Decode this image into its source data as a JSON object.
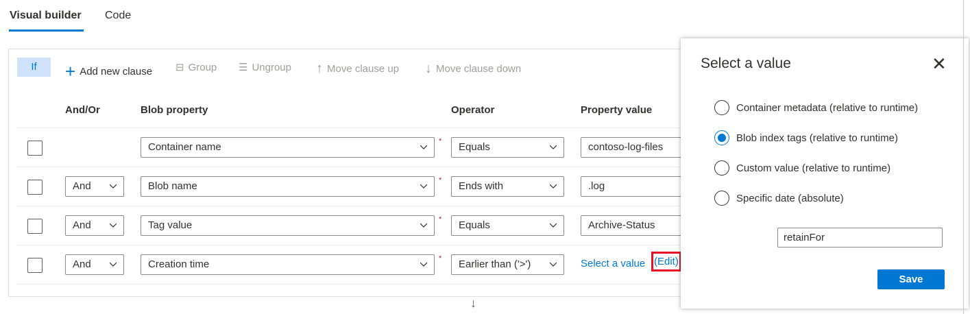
{
  "tabs": [
    {
      "label": "Visual builder",
      "active": true
    },
    {
      "label": "Code",
      "active": false
    }
  ],
  "toolbar": {
    "if_label": "If",
    "add": "Add new clause",
    "group": "Group",
    "ungroup": "Ungroup",
    "up": "Move clause up",
    "down": "Move clause down"
  },
  "headers": {
    "andor": "And/Or",
    "property": "Blob property",
    "operator": "Operator",
    "value": "Property value"
  },
  "rows": [
    {
      "andor": "",
      "property": "Container name",
      "operator": "Equals",
      "value": "contoso-log-files"
    },
    {
      "andor": "And",
      "property": "Blob name",
      "operator": "Ends with",
      "value": ".log"
    },
    {
      "andor": "And",
      "property": "Tag value",
      "operator": "Equals",
      "value": "Archive-Status"
    },
    {
      "andor": "And",
      "property": "Creation time",
      "operator": "Earlier than ('>')",
      "value": "Select a value",
      "edit": "(Edit)"
    }
  ],
  "panel": {
    "title": "Select a value",
    "options": [
      "Container metadata (relative to runtime)",
      "Blob index tags (relative to runtime)",
      "Custom value (relative to runtime)",
      "Specific date (absolute)"
    ],
    "selected_index": 1,
    "input_value": "retainFor",
    "save": "Save"
  },
  "colors": {
    "accent": "#0078d4",
    "highlight": "#e81123"
  }
}
